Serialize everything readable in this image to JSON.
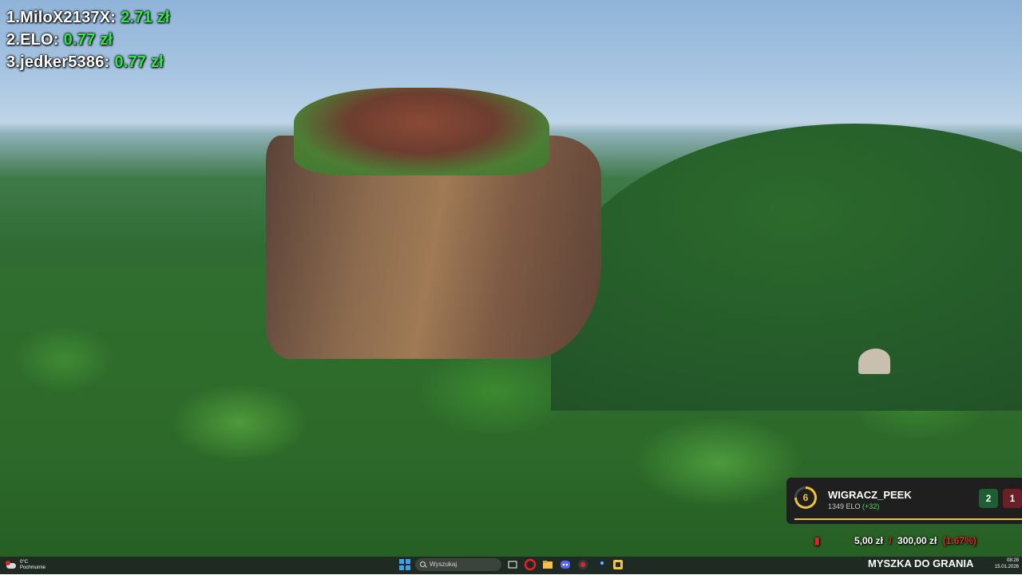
{
  "leaderboard": [
    {
      "rank": "1.",
      "name": "MiloX2137X:",
      "amount": "2.71 zł"
    },
    {
      "rank": "2.",
      "name": "ELO:",
      "amount": "0.77 zł"
    },
    {
      "rank": "3.",
      "name": "jedker5386:",
      "amount": "0.77 zł"
    }
  ],
  "player": {
    "level": "6",
    "name": "WIGRACZ_PEEK",
    "elo": "1349 ELO",
    "elo_gain": "(+32)",
    "wins": "2",
    "losses": "1"
  },
  "money": {
    "current": "5,00 zł",
    "separator": "/",
    "goal": "300,00 zł",
    "percent": "(1.67%)"
  },
  "taskbar": {
    "weather_temp": "0°C",
    "weather_desc": "Pochmurnie",
    "search_placeholder": "Wyszukaj",
    "label": "MYSZKA DO GRANIA",
    "time": "08:28",
    "date": "15.01.2026"
  },
  "colors": {
    "leaderboard_amount": "#2ee84a",
    "accent_red": "#e5222a",
    "level_gold": "#f0c23a"
  }
}
